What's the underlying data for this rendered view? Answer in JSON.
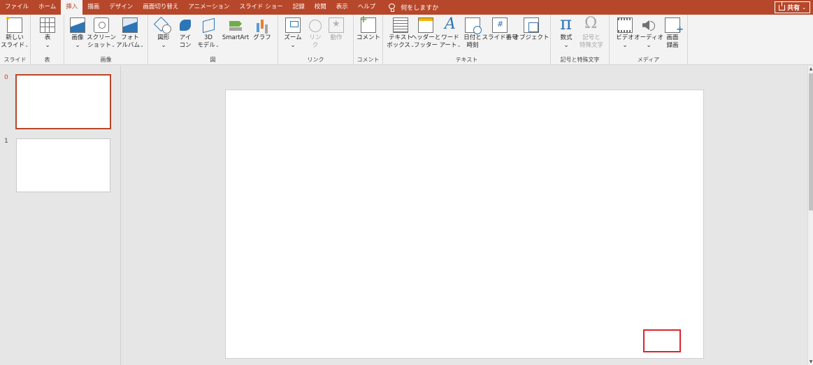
{
  "tabs": [
    "ファイル",
    "ホーム",
    "挿入",
    "描画",
    "デザイン",
    "画面切り替え",
    "アニメーション",
    "スライド ショー",
    "記録",
    "校閲",
    "表示",
    "ヘルプ"
  ],
  "active_tab_index": 2,
  "tell_me": "何をしますか",
  "share_label": "共有",
  "ribbon": {
    "groups": {
      "slides": "スライド",
      "tables": "表",
      "images": "画像",
      "illustrations": "図",
      "links": "リンク",
      "comments": "コメント",
      "text": "テキスト",
      "symbols": "記号と特殊文字",
      "media": "メディア"
    },
    "buttons": {
      "new_slide_1": "新しい",
      "new_slide_2": "スライド",
      "table": "表",
      "image": "画像",
      "screenshot_1": "スクリーン",
      "screenshot_2": "ショット",
      "photo_album_1": "フォト",
      "photo_album_2": "アルバム",
      "shapes": "図形",
      "icons_1": "アイ",
      "icons_2": "コン",
      "model3d_1": "3D",
      "model3d_2": "モデル",
      "smartart": "SmartArt",
      "chart": "グラフ",
      "zoom": "ズーム",
      "link_1": "リン",
      "link_2": "ク",
      "action": "動作",
      "comment": "コメント",
      "textbox_1": "テキスト",
      "textbox_2": "ボックス",
      "header_1": "ヘッダーと",
      "header_2": "フッター",
      "wordart_1": "ワード",
      "wordart_2": "アート",
      "datetime_1": "日付と",
      "datetime_2": "時刻",
      "slide_number": "スライド番号",
      "object": "オブジェクト",
      "equation": "数式",
      "symbol_1": "記号と",
      "symbol_2": "特殊文字",
      "video": "ビデオ",
      "audio": "オーディオ",
      "screen_recording_1": "画面",
      "screen_recording_2": "録画"
    }
  },
  "slides": [
    {
      "number": "0",
      "selected": true
    },
    {
      "number": "1",
      "selected": false
    }
  ],
  "colors": {
    "accent": "#b7472a",
    "highlight_box": "#d9262e"
  }
}
